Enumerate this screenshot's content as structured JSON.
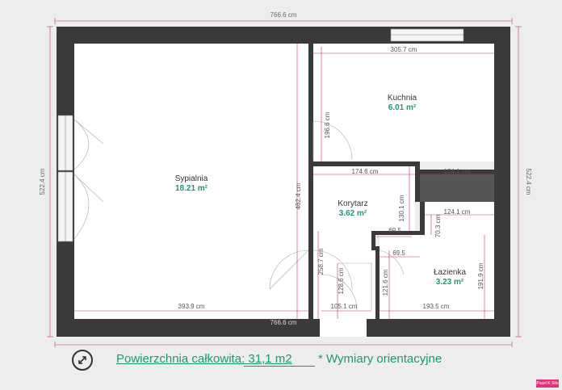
{
  "dimensions": {
    "top_total": "766.6 cm",
    "bottom_total": "766.6 cm",
    "left_total": "522.4 cm",
    "right_total": "522.4 cm",
    "kitchen_width": "305.7 cm",
    "kitchen_height": "196.6 cm",
    "bedroom_height": "462.4 cm",
    "bedroom_width": "393.9 cm",
    "hall_width": "174.6 cm",
    "hall_height": "130.1 cm",
    "bath_top_width": "124.1 cm",
    "bath_width": "124.1 cm",
    "bath_step_height": "70.3 cm",
    "step_a": "69.5",
    "step_b": "69.5",
    "hall_left_height": "258.7 cm",
    "closet_height": "128.6 cm",
    "closet_side_height": "121.6 cm",
    "bath_height": "191.9 cm",
    "closet_width": "105.1 cm",
    "bath_bottom_width": "193.5 cm"
  },
  "rooms": {
    "bedroom": {
      "name": "Sypialnia",
      "area": "18.21 m²"
    },
    "kitchen": {
      "name": "Kuchnia",
      "area": "6.01 m²"
    },
    "hall": {
      "name": "Korytarz",
      "area": "3.62 m²"
    },
    "bathroom": {
      "name": "Łazienka",
      "area": "3.23 m²"
    }
  },
  "footer": {
    "total_area": "Powierzchnia całkowita: 31,1 m2",
    "note": "* Wymiary orientacyjne"
  },
  "icons": {
    "compass": "compass-icon"
  },
  "colors": {
    "wall": "#3a3a3a",
    "dimension_line": "#c0307e",
    "accent_text": "#1e9a68",
    "background": "#ededed"
  },
  "badge": "Pasel K Site"
}
